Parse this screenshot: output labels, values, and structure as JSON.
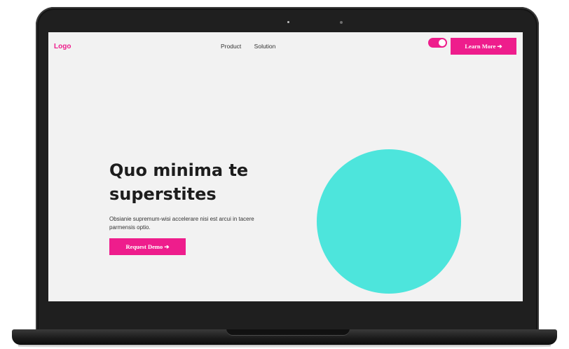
{
  "header": {
    "logo": "Logo",
    "nav": [
      "Product",
      "Solution"
    ],
    "toggle_on": true,
    "cta_label": "Learn More ➔"
  },
  "hero": {
    "title": "Quo minima te superstites",
    "description": "Obsianie supremum-wisi accelerare nisi est arcui in tacere parmensis optio.",
    "cta_label": "Request Demo ➔"
  },
  "colors": {
    "accent": "#ee1d8c",
    "circle": "#4de5dc",
    "background": "#f2f2f2"
  }
}
